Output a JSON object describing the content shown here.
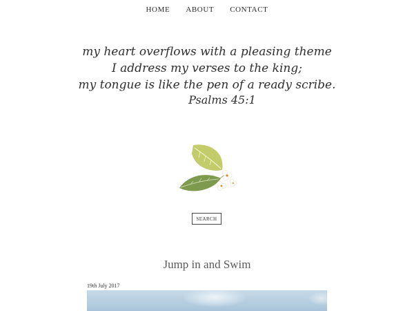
{
  "nav": {
    "items": [
      "HOME",
      "ABOUT",
      "CONTACT"
    ]
  },
  "header": {
    "verse_lines": [
      "my heart overflows with a pleasing theme",
      "I address my verses to the king;",
      "my tongue is like the pen of a ready scribe."
    ],
    "reference": "Psalms 45:1"
  },
  "logo": {
    "icon": "leaves-flowers-icon",
    "colors": {
      "light_leaf": "#c2cc6a",
      "dark_leaf": "#7e9a4e",
      "flower": "#ffffff",
      "flower_center": "#d98a2b"
    }
  },
  "search": {
    "label": "SEARCH"
  },
  "post": {
    "title": "Jump in and Swim",
    "date": "19th July 2017"
  }
}
